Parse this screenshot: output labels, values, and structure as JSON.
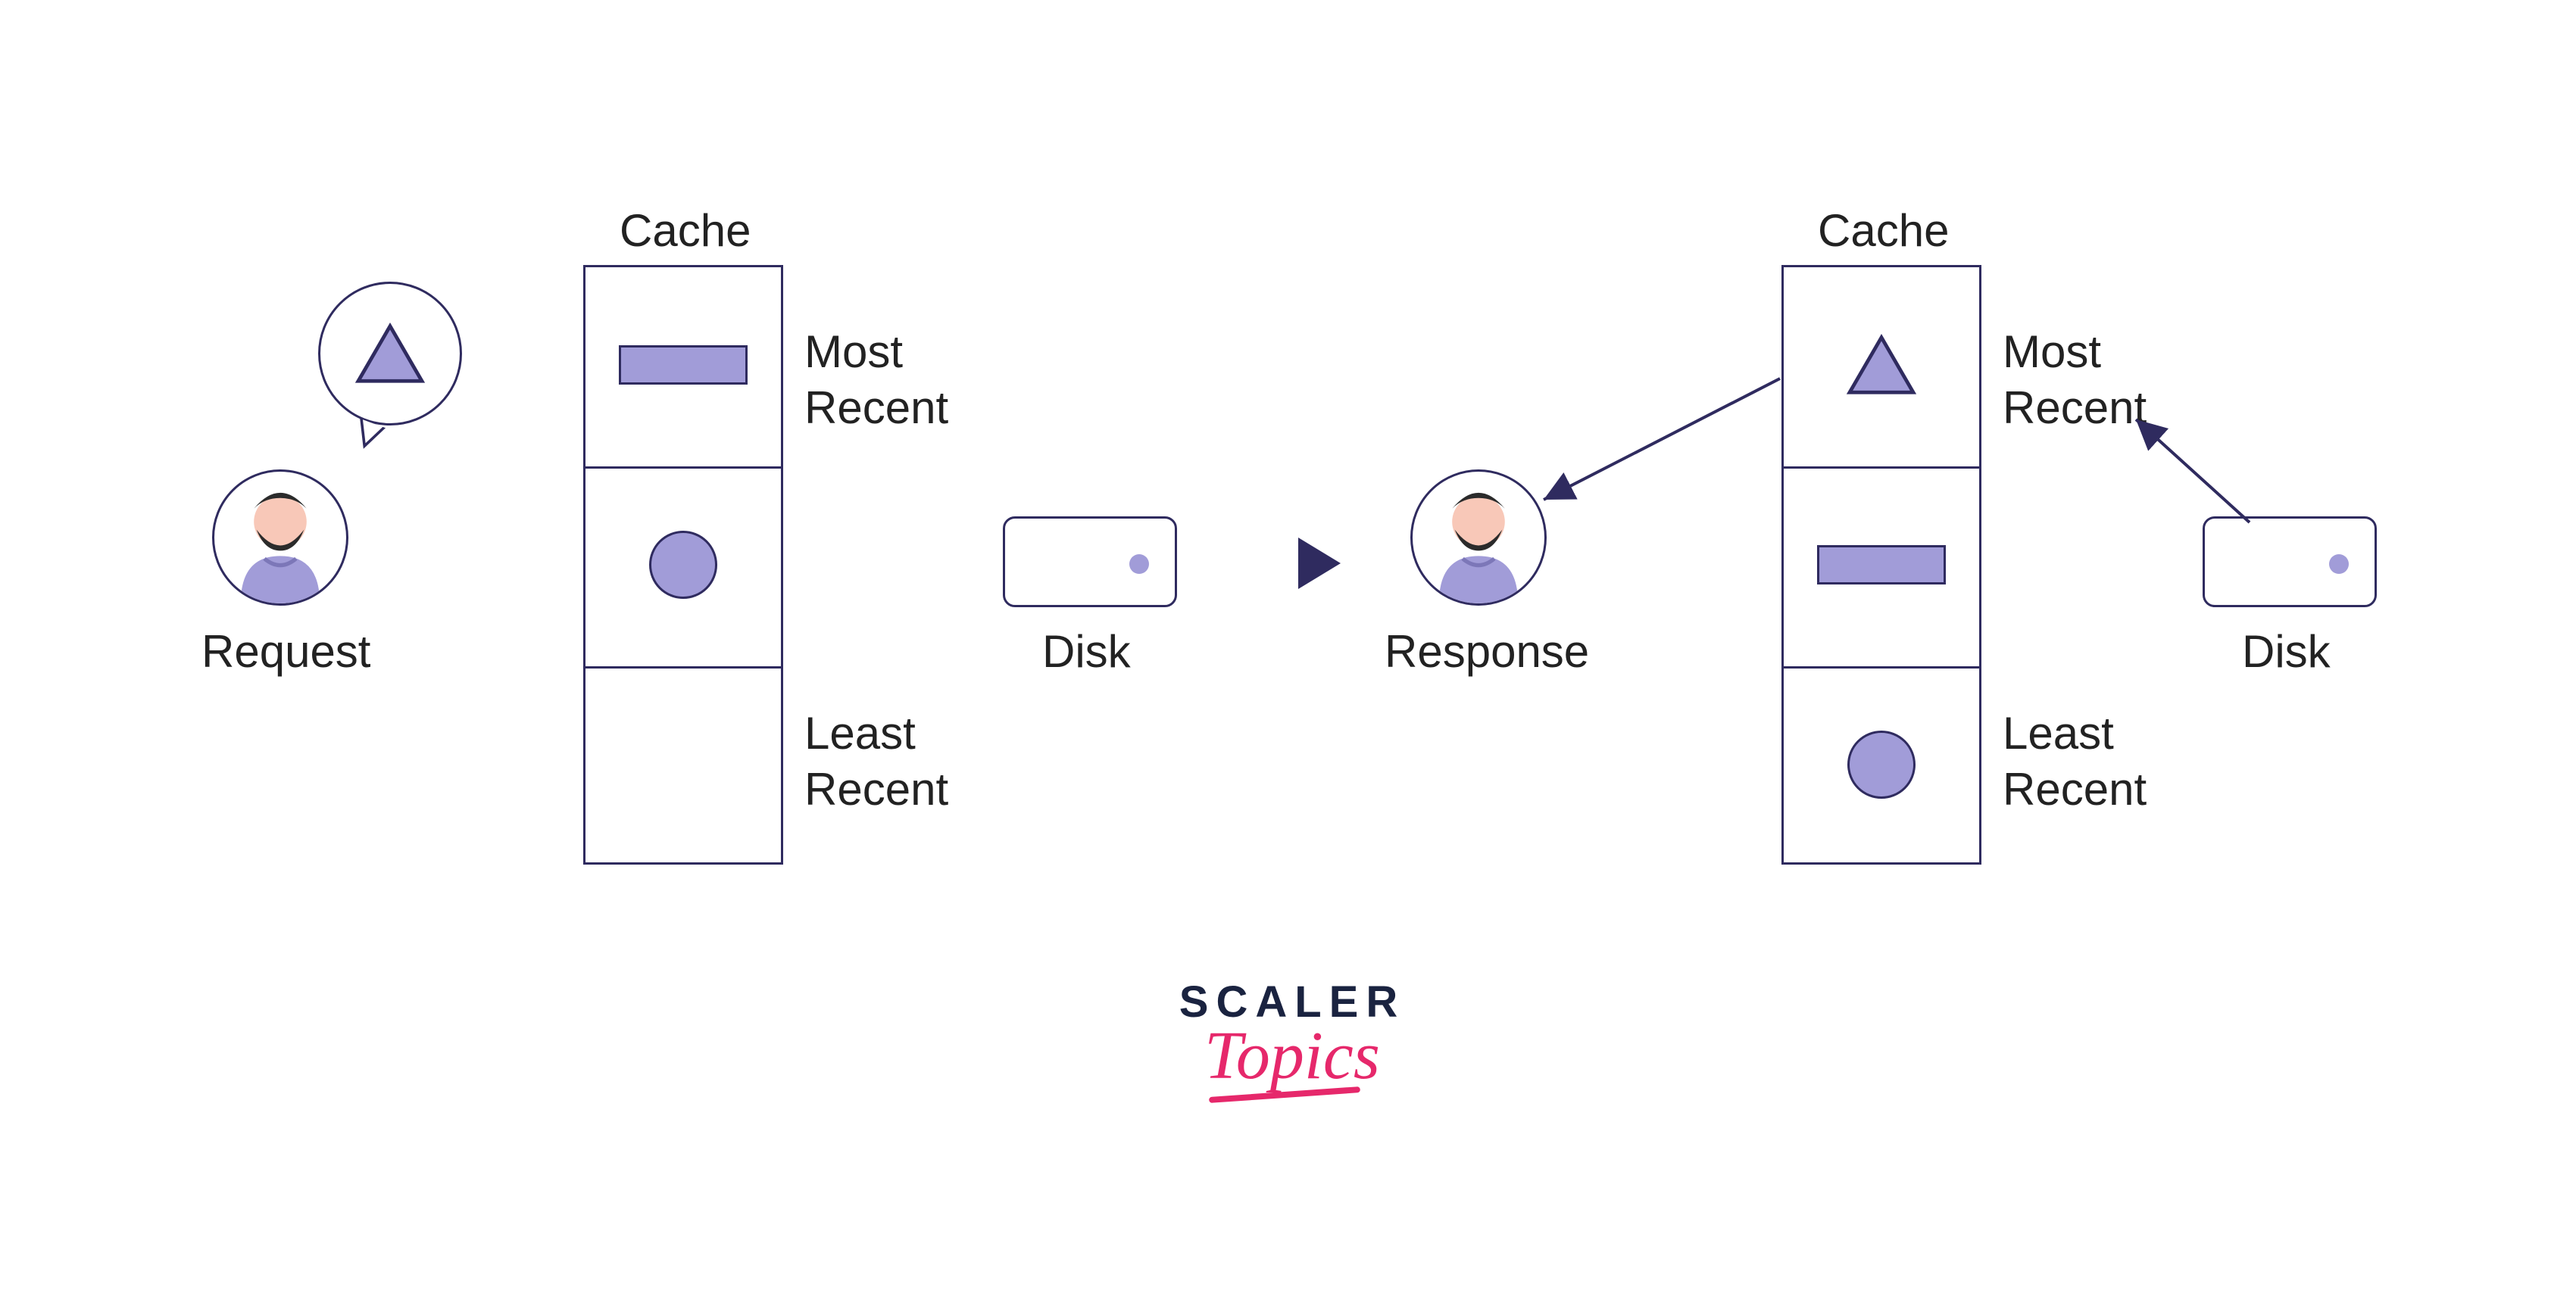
{
  "left": {
    "user_label": "Request",
    "cache_title": "Cache",
    "most_recent": "Most",
    "most_recent2": "Recent",
    "least_recent": "Least",
    "least_recent2": "Recent",
    "disk_label": "Disk",
    "cache_slots": [
      "rectangle",
      "circle",
      "empty"
    ]
  },
  "right": {
    "user_label": "Response",
    "cache_title": "Cache",
    "most_recent": "Most",
    "most_recent2": "Recent",
    "least_recent": "Least",
    "least_recent2": "Recent",
    "disk_label": "Disk",
    "cache_slots": [
      "triangle",
      "rectangle",
      "circle"
    ]
  },
  "logo": {
    "brand": "SCALER",
    "sub": "Topics"
  },
  "colors": {
    "shape_fill": "#a19cd8",
    "outline": "#2f2b5f",
    "logo_dark": "#1a2340",
    "logo_pink": "#e6286b"
  }
}
